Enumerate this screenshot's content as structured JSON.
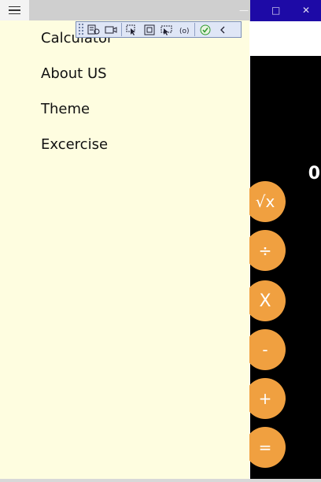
{
  "nav": {
    "items": [
      {
        "label": "Calculator"
      },
      {
        "label": "About US"
      },
      {
        "label": "Theme"
      },
      {
        "label": "Excercise"
      }
    ]
  },
  "calculator": {
    "display": "0",
    "buttons": [
      {
        "label": "√x"
      },
      {
        "label": "÷"
      },
      {
        "label": "X"
      },
      {
        "label": "-"
      },
      {
        "label": "+"
      },
      {
        "label": "="
      }
    ]
  },
  "window": {
    "controls": [
      "—",
      "□",
      "✕"
    ]
  },
  "debug_toolbar": {
    "tools": [
      "live-visual-tree-icon",
      "record-icon",
      "select-element-icon",
      "display-layout-adorners-icon",
      "track-focus-icon",
      "binding-failures-icon",
      "accessibility-check-icon",
      "collapse-icon"
    ]
  },
  "colors": {
    "drawer_bg": "#fefde0",
    "accent_button": "#f0a040",
    "title_bar": "#1d0aa6",
    "calc_bg": "#000000"
  }
}
